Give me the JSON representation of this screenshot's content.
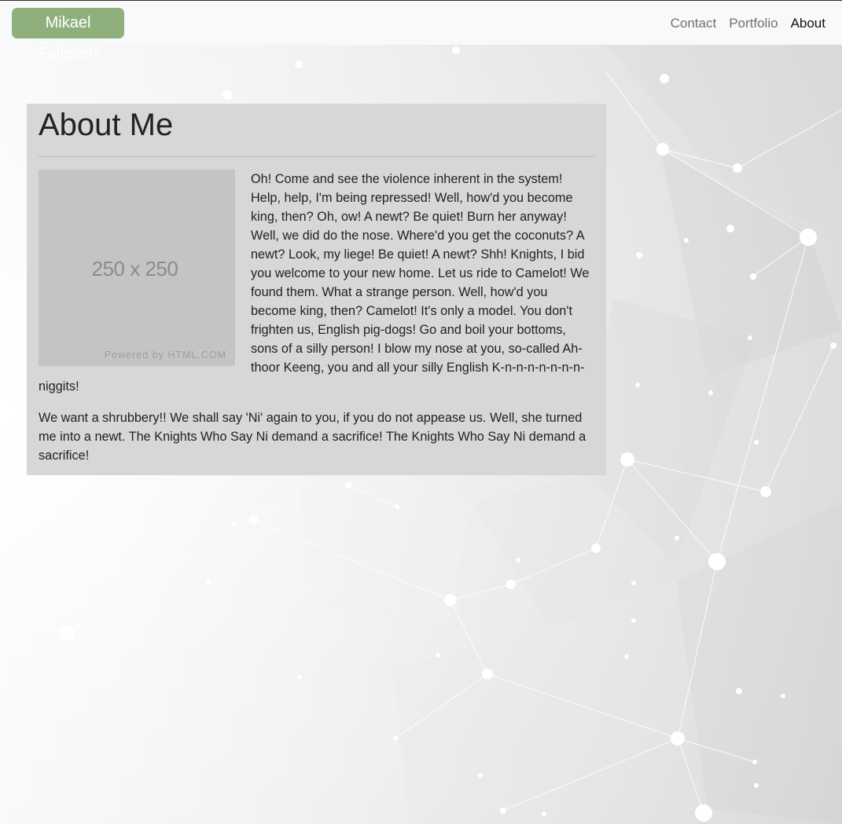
{
  "navbar": {
    "brand": "Mikael Fallesen",
    "links": [
      {
        "label": "Contact"
      },
      {
        "label": "Portfolio"
      },
      {
        "label": "About"
      }
    ]
  },
  "about": {
    "title": "About Me",
    "image": {
      "dimensions_label": "250 x 250",
      "credit": "Powered by HTML.COM"
    },
    "paragraphs": [
      "Oh! Come and see the violence inherent in the system! Help, help, I'm being repressed! Well, how'd you become king, then? Oh, ow! A newt? Be quiet! Burn her anyway! Well, we did do the nose. Where'd you get the coconuts? A newt? Look, my liege! Be quiet! A newt? Shh! Knights, I bid you welcome to your new home. Let us ride to Camelot! We found them. What a strange person. Well, how'd you become king, then? Camelot! It's only a model. You don't frighten us, English pig-dogs! Go and boil your bottoms, sons of a silly person! I blow my nose at you, so-called Ah-thoor Keeng, you and all your silly English K-n-n-n-n-n-n-n-niggits!",
      "We want a shrubbery!! We shall say 'Ni' again to you, if you do not appease us. Well, she turned me into a newt. The Knights Who Say Ni demand a sacrifice! The Knights Who Say Ni demand a sacrifice!"
    ]
  },
  "colors": {
    "brand_bg": "#8fb07d",
    "navbar_bg": "#f8f9fa",
    "card_bg": "#d6d6d6"
  }
}
